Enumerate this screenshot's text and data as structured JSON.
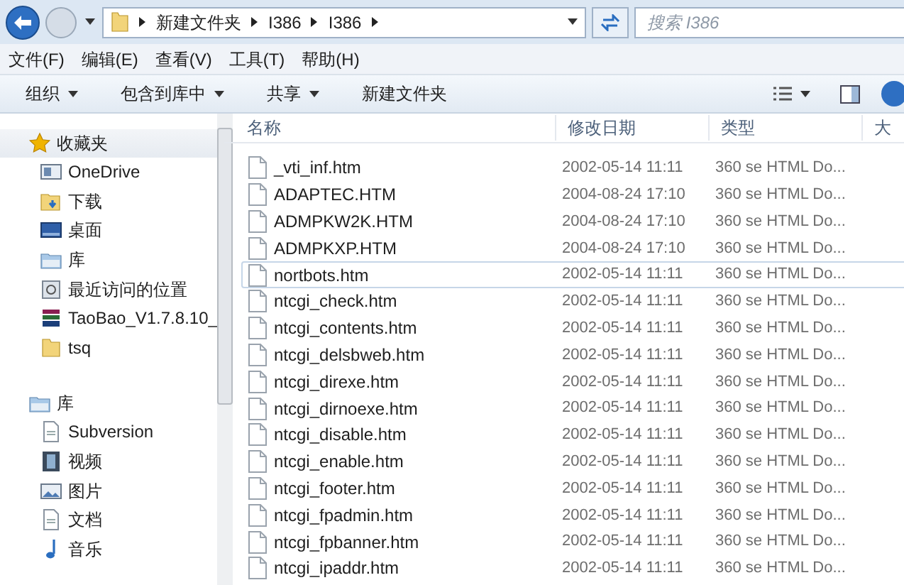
{
  "address_bar": {
    "path": [
      "新建文件夹",
      "I386",
      "I386"
    ]
  },
  "search": {
    "placeholder": "搜索 I386"
  },
  "menu": [
    "文件(F)",
    "编辑(E)",
    "查看(V)",
    "工具(T)",
    "帮助(H)"
  ],
  "toolbar": [
    {
      "label": "组织",
      "dropdown": true
    },
    {
      "label": "包含到库中",
      "dropdown": true
    },
    {
      "label": "共享",
      "dropdown": true
    },
    {
      "label": "新建文件夹",
      "dropdown": false
    }
  ],
  "sidebar": {
    "groups": [
      {
        "label": "收藏夹",
        "kind": "star",
        "highlighted": true,
        "items": [
          {
            "label": "OneDrive",
            "kind": "drive"
          },
          {
            "label": "下载",
            "kind": "download"
          },
          {
            "label": "桌面",
            "kind": "desktop"
          },
          {
            "label": "库",
            "kind": "library"
          },
          {
            "label": "最近访问的位置",
            "kind": "recent"
          },
          {
            "label": "TaoBao_V1.7.8.10_",
            "kind": "archive"
          },
          {
            "label": "tsq",
            "kind": "folder"
          }
        ]
      },
      {
        "label": "库",
        "kind": "library",
        "highlighted": false,
        "items": [
          {
            "label": "Subversion",
            "kind": "doc"
          },
          {
            "label": "视频",
            "kind": "video"
          },
          {
            "label": "图片",
            "kind": "picture"
          },
          {
            "label": "文档",
            "kind": "doc"
          },
          {
            "label": "音乐",
            "kind": "music"
          }
        ]
      }
    ]
  },
  "table": {
    "columns": [
      "名称",
      "修改日期",
      "类型",
      "大"
    ],
    "rows": [
      {
        "name": "_vti_inf.htm",
        "date": "2002-05-14 11:11",
        "type": "360 se HTML Do...",
        "selected": false
      },
      {
        "name": "ADAPTEC.HTM",
        "date": "2004-08-24 17:10",
        "type": "360 se HTML Do...",
        "selected": false
      },
      {
        "name": "ADMPKW2K.HTM",
        "date": "2004-08-24 17:10",
        "type": "360 se HTML Do...",
        "selected": false
      },
      {
        "name": "ADMPKXP.HTM",
        "date": "2004-08-24 17:10",
        "type": "360 se HTML Do...",
        "selected": false
      },
      {
        "name": "nortbots.htm",
        "date": "2002-05-14 11:11",
        "type": "360 se HTML Do...",
        "selected": true
      },
      {
        "name": "ntcgi_check.htm",
        "date": "2002-05-14 11:11",
        "type": "360 se HTML Do...",
        "selected": false
      },
      {
        "name": "ntcgi_contents.htm",
        "date": "2002-05-14 11:11",
        "type": "360 se HTML Do...",
        "selected": false
      },
      {
        "name": "ntcgi_delsbweb.htm",
        "date": "2002-05-14 11:11",
        "type": "360 se HTML Do...",
        "selected": false
      },
      {
        "name": "ntcgi_direxe.htm",
        "date": "2002-05-14 11:11",
        "type": "360 se HTML Do...",
        "selected": false
      },
      {
        "name": "ntcgi_dirnoexe.htm",
        "date": "2002-05-14 11:11",
        "type": "360 se HTML Do...",
        "selected": false
      },
      {
        "name": "ntcgi_disable.htm",
        "date": "2002-05-14 11:11",
        "type": "360 se HTML Do...",
        "selected": false
      },
      {
        "name": "ntcgi_enable.htm",
        "date": "2002-05-14 11:11",
        "type": "360 se HTML Do...",
        "selected": false
      },
      {
        "name": "ntcgi_footer.htm",
        "date": "2002-05-14 11:11",
        "type": "360 se HTML Do...",
        "selected": false
      },
      {
        "name": "ntcgi_fpadmin.htm",
        "date": "2002-05-14 11:11",
        "type": "360 se HTML Do...",
        "selected": false
      },
      {
        "name": "ntcgi_fpbanner.htm",
        "date": "2002-05-14 11:11",
        "type": "360 se HTML Do...",
        "selected": false
      },
      {
        "name": "ntcgi_ipaddr.htm",
        "date": "2002-05-14 11:11",
        "type": "360 se HTML Do...",
        "selected": false
      }
    ]
  }
}
